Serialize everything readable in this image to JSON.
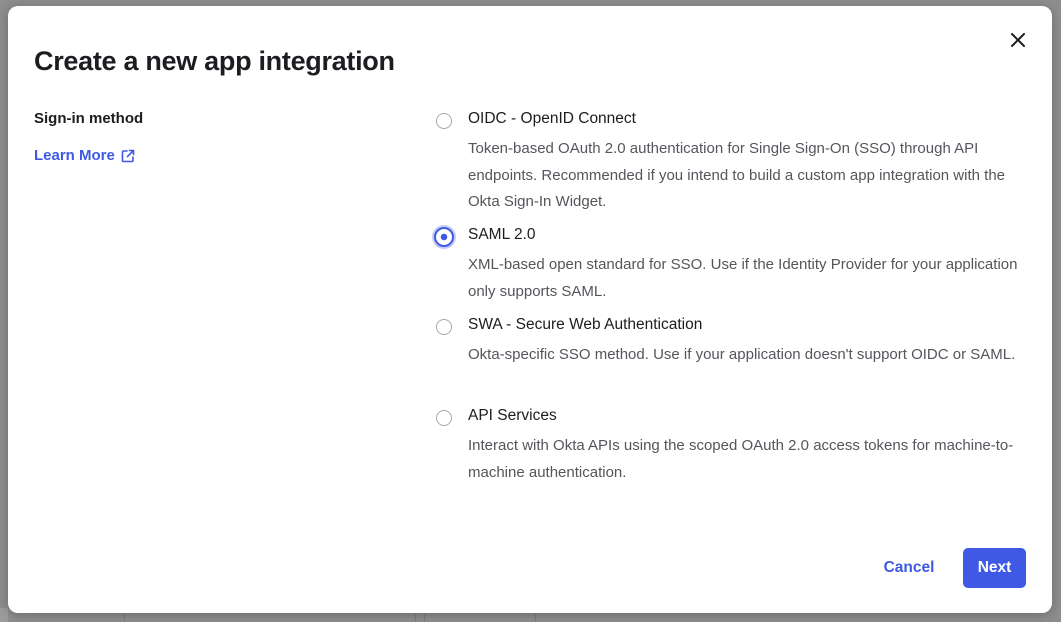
{
  "modal": {
    "title": "Create a new app integration",
    "close_icon": "close-icon"
  },
  "sign_in": {
    "label": "Sign-in method",
    "learn_more": "Learn More",
    "learn_more_icon": "external-link-icon",
    "selected": "SAML 2.0",
    "options": [
      {
        "title": "OIDC - OpenID Connect",
        "description": "Token-based OAuth 2.0 authentication for Single Sign-On (SSO) through API endpoints. Recommended if you intend to build a custom app integration with the Okta Sign-In Widget."
      },
      {
        "title": "SAML 2.0",
        "description": "XML-based open standard for SSO. Use if the Identity Provider for your application only supports SAML."
      },
      {
        "title": "SWA - Secure Web Authentication",
        "description": "Okta-specific SSO method. Use if your application doesn't support OIDC or SAML."
      },
      {
        "title": "API Services",
        "description": "Interact with Okta APIs using the scoped OAuth 2.0 access tokens for machine-to-machine authentication."
      }
    ]
  },
  "footer": {
    "cancel_label": "Cancel",
    "next_label": "Next"
  },
  "colors": {
    "accent": "#3f59e4",
    "text": "#1d1d21",
    "muted_text": "#55555c",
    "overlay": "#8e8e8e"
  }
}
